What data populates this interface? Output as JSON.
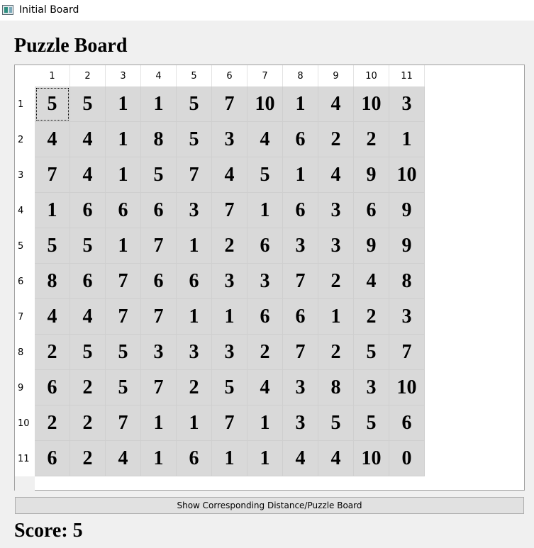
{
  "window": {
    "title": "Initial Board",
    "icon": "app-window-icon"
  },
  "heading": "Puzzle Board",
  "board": {
    "column_headers": [
      "1",
      "2",
      "3",
      "4",
      "5",
      "6",
      "7",
      "8",
      "9",
      "10",
      "11"
    ],
    "row_headers": [
      "1",
      "2",
      "3",
      "4",
      "5",
      "6",
      "7",
      "8",
      "9",
      "10",
      "11"
    ],
    "focused_cell": {
      "row": 1,
      "column": 1
    },
    "rows": [
      [
        "5",
        "5",
        "1",
        "1",
        "5",
        "7",
        "10",
        "1",
        "4",
        "10",
        "3"
      ],
      [
        "4",
        "4",
        "1",
        "8",
        "5",
        "3",
        "4",
        "6",
        "2",
        "2",
        "1"
      ],
      [
        "7",
        "4",
        "1",
        "5",
        "7",
        "4",
        "5",
        "1",
        "4",
        "9",
        "10"
      ],
      [
        "1",
        "6",
        "6",
        "6",
        "3",
        "7",
        "1",
        "6",
        "3",
        "6",
        "9"
      ],
      [
        "5",
        "5",
        "1",
        "7",
        "1",
        "2",
        "6",
        "3",
        "3",
        "9",
        "9"
      ],
      [
        "8",
        "6",
        "7",
        "6",
        "6",
        "3",
        "3",
        "7",
        "2",
        "4",
        "8"
      ],
      [
        "4",
        "4",
        "7",
        "7",
        "1",
        "1",
        "6",
        "6",
        "1",
        "2",
        "3"
      ],
      [
        "2",
        "5",
        "5",
        "3",
        "3",
        "3",
        "2",
        "7",
        "2",
        "5",
        "7"
      ],
      [
        "6",
        "2",
        "5",
        "7",
        "2",
        "5",
        "4",
        "3",
        "8",
        "3",
        "10"
      ],
      [
        "2",
        "2",
        "7",
        "1",
        "1",
        "7",
        "1",
        "3",
        "5",
        "5",
        "6"
      ],
      [
        "6",
        "2",
        "4",
        "1",
        "6",
        "1",
        "1",
        "4",
        "4",
        "10",
        "0"
      ]
    ]
  },
  "show_button_label": "Show Corresponding Distance/Puzzle Board",
  "score_text": "Score: 5"
}
